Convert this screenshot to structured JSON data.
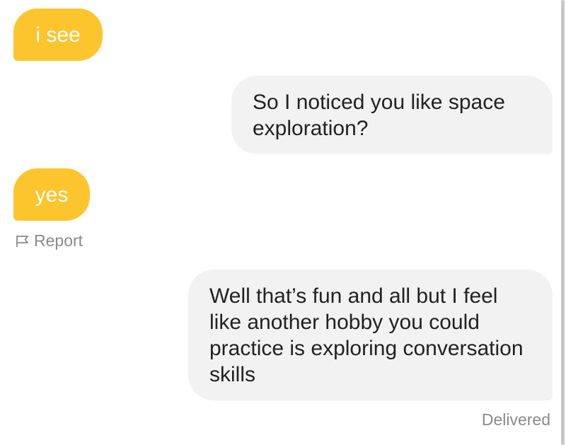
{
  "messages": [
    {
      "sender": "them",
      "text": "i see"
    },
    {
      "sender": "me",
      "text": "So I noticed you like space exploration?"
    },
    {
      "sender": "them",
      "text": "yes"
    },
    {
      "sender": "me",
      "text": "Well that’s fun and all but I feel like another hobby you could practice is exploring conversation skills"
    }
  ],
  "report": {
    "label": "Report",
    "icon": "flag-icon"
  },
  "status": {
    "label": "Delivered"
  },
  "colors": {
    "incoming_bubble": "#fcc52e",
    "outgoing_bubble": "#f2f2f2",
    "meta_text": "#8a8a8a"
  }
}
